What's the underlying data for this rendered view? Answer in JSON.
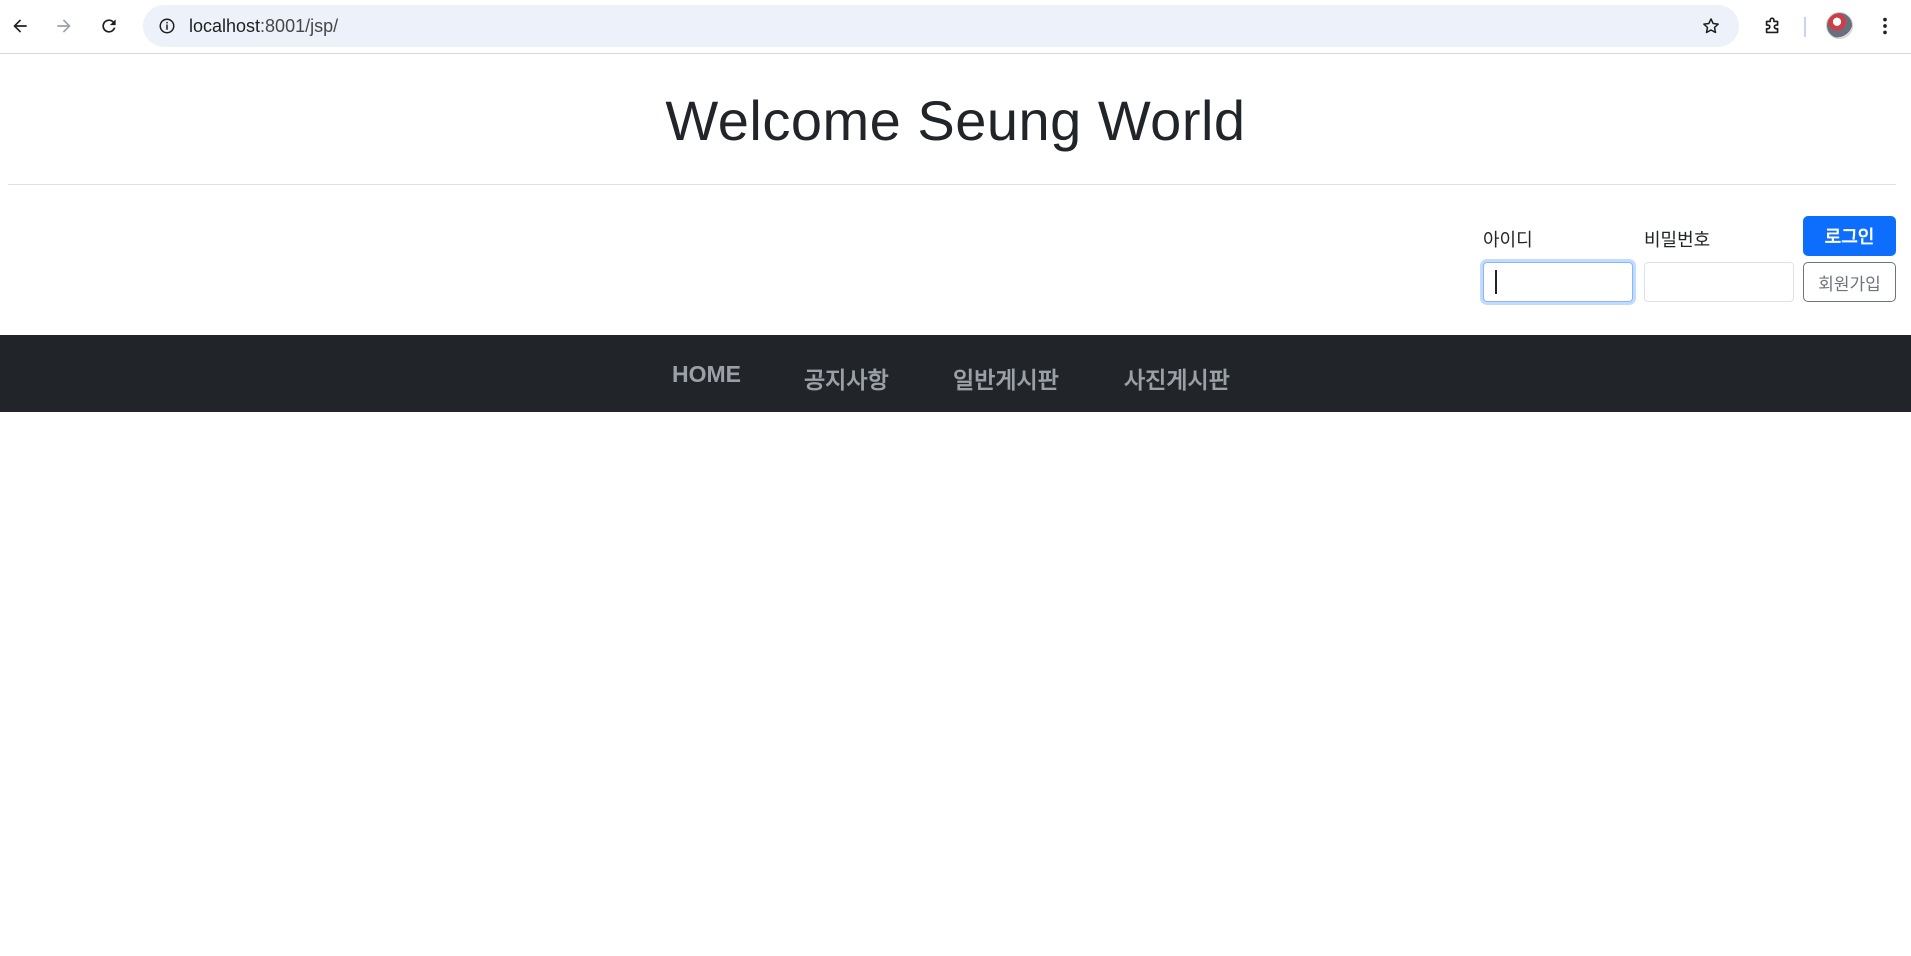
{
  "browser": {
    "url_host": "localhost",
    "url_rest": ":8001/jsp/",
    "back_icon": "arrow-left-icon",
    "forward_icon": "arrow-right-icon",
    "reload_icon": "reload-icon",
    "info_icon": "info-icon",
    "bookmark_icon": "star-icon",
    "extensions_icon": "puzzle-icon",
    "menu_icon": "kebab-menu-icon"
  },
  "header": {
    "title": "Welcome Seung World"
  },
  "login": {
    "id_label": "아이디",
    "id_value": "",
    "password_label": "비밀번호",
    "password_value": "",
    "login_button": "로그인",
    "signup_button": "회원가입"
  },
  "nav": {
    "items": [
      {
        "label": "HOME"
      },
      {
        "label": "공지사항"
      },
      {
        "label": "일반게시판"
      },
      {
        "label": "사진게시판"
      }
    ]
  },
  "colors": {
    "primary": "#0d6efd",
    "nav_bg": "#212529",
    "nav_text": "#9aa0a6",
    "secondary": "#6c757d"
  }
}
